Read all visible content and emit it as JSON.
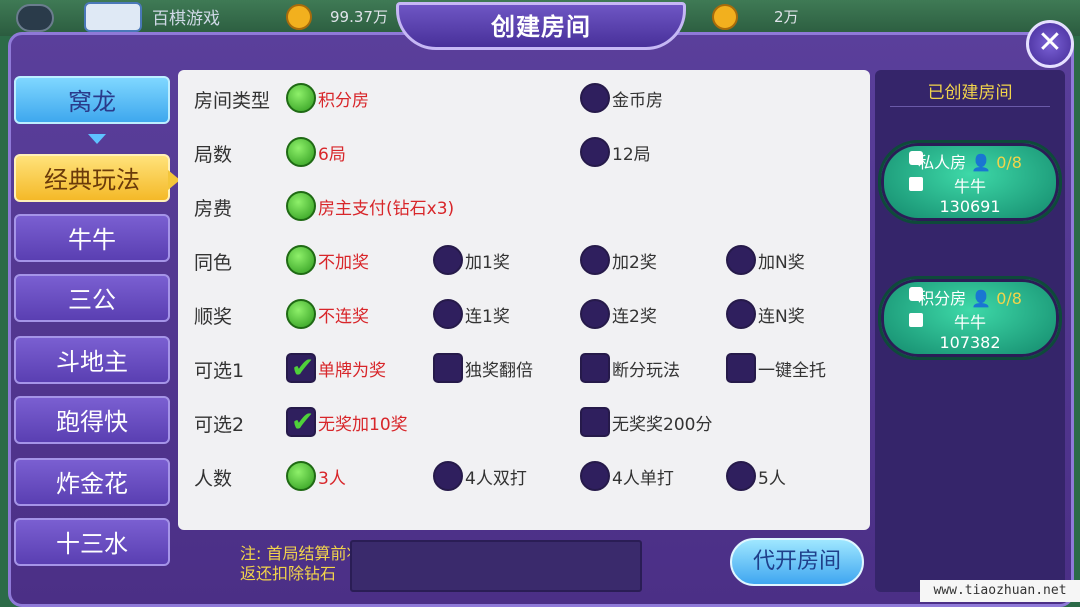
{
  "topbar": {
    "game_name": "百棋游戏",
    "coins": "99.37万",
    "coins2": "2万"
  },
  "dialog": {
    "title": "创建房间",
    "close_symbol": "✕"
  },
  "categories": [
    {
      "label": "窝龙",
      "state": "blue"
    },
    {
      "label": "经典玩法",
      "state": "selected"
    },
    {
      "label": "牛牛",
      "state": "normal"
    },
    {
      "label": "三公",
      "state": "normal"
    },
    {
      "label": "斗地主",
      "state": "normal"
    },
    {
      "label": "跑得快",
      "state": "normal"
    },
    {
      "label": "炸金花",
      "state": "normal"
    },
    {
      "label": "十三水",
      "state": "normal"
    }
  ],
  "options": [
    {
      "label": "房间类型",
      "type": "radio",
      "items": [
        {
          "text": "积分房",
          "on": true
        },
        {
          "text": "金币房",
          "on": false
        }
      ]
    },
    {
      "label": "局数",
      "type": "radio",
      "items": [
        {
          "text": "6局",
          "on": true
        },
        {
          "text": "12局",
          "on": false
        }
      ]
    },
    {
      "label": "房费",
      "type": "radio",
      "items": [
        {
          "text": "房主支付(钻石x3)",
          "on": true
        }
      ]
    },
    {
      "label": "同色",
      "type": "radio",
      "items": [
        {
          "text": "不加奖",
          "on": true
        },
        {
          "text": "加1奖",
          "on": false
        },
        {
          "text": "加2奖",
          "on": false
        },
        {
          "text": "加N奖",
          "on": false
        }
      ]
    },
    {
      "label": "顺奖",
      "type": "radio",
      "items": [
        {
          "text": "不连奖",
          "on": true
        },
        {
          "text": "连1奖",
          "on": false
        },
        {
          "text": "连2奖",
          "on": false
        },
        {
          "text": "连N奖",
          "on": false
        }
      ]
    },
    {
      "label": "可选1",
      "type": "check",
      "items": [
        {
          "text": "单牌为奖",
          "on": true
        },
        {
          "text": "独奖翻倍",
          "on": false
        },
        {
          "text": "断分玩法",
          "on": false
        },
        {
          "text": "一键全托",
          "on": false
        }
      ]
    },
    {
      "label": "可选2",
      "type": "check",
      "items": [
        {
          "text": "无奖加10奖",
          "on": true
        },
        {
          "text": "无奖奖200分",
          "on": false
        }
      ]
    },
    {
      "label": "人数",
      "type": "radio",
      "items": [
        {
          "text": "3人",
          "on": true
        },
        {
          "text": "4人双打",
          "on": false
        },
        {
          "text": "4人单打",
          "on": false
        },
        {
          "text": "5人",
          "on": false
        }
      ]
    }
  ],
  "footer": {
    "note_line1": "注: 首局结算前将",
    "note_line2": "返还扣除钻石",
    "open_button": "代开房间"
  },
  "created_rooms": {
    "title": "已创建房间",
    "rooms": [
      {
        "type": "私人房",
        "count": "0/8",
        "game": "牛牛",
        "id": "130691"
      },
      {
        "type": "积分房",
        "count": "0/8",
        "game": "牛牛",
        "id": "107382"
      }
    ]
  },
  "watermark": "www.tiaozhuan.net"
}
